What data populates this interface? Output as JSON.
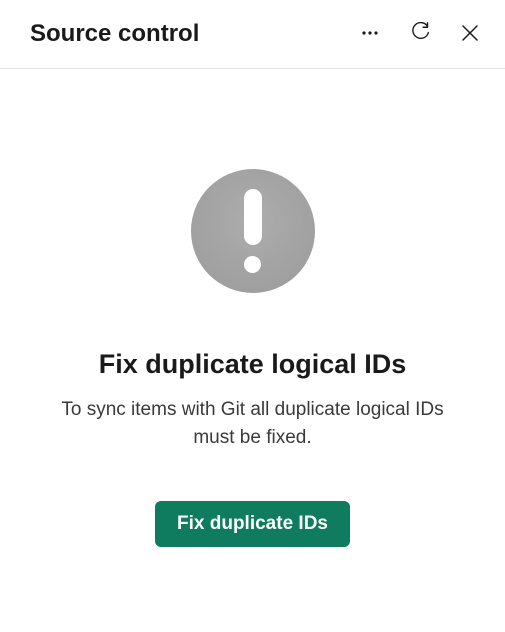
{
  "header": {
    "title": "Source control"
  },
  "content": {
    "title": "Fix duplicate logical IDs",
    "description": "To sync items with Git all duplicate logical IDs must be fixed.",
    "button_label": "Fix duplicate IDs"
  },
  "colors": {
    "primary": "#0f7b5f"
  }
}
